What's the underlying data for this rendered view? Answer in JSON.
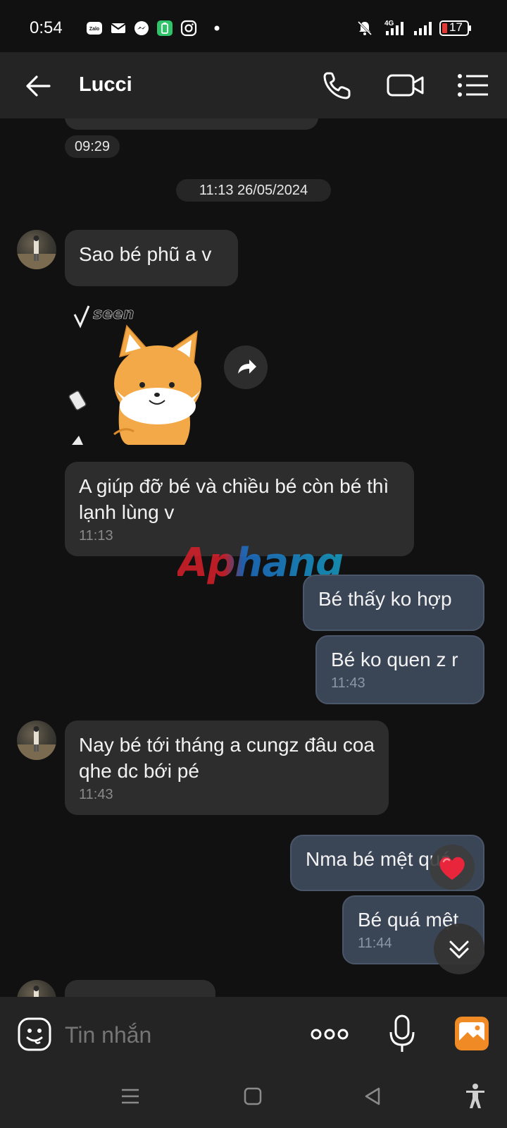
{
  "status_bar": {
    "time": "0:54",
    "battery": "17",
    "network": "4G",
    "icons": [
      "zalo-icon",
      "mail-icon",
      "messenger-icon",
      "battery-app-icon",
      "instagram-icon",
      "dot-icon",
      "mute-icon",
      "signal-icon",
      "battery-icon"
    ]
  },
  "header": {
    "title": "Lucci"
  },
  "messages": {
    "prev_time": "09:29",
    "date_divider": "11:13 26/05/2024",
    "m1": {
      "text": "Sao bé phũ a v"
    },
    "sticker": {
      "caption": "seen"
    },
    "m2": {
      "text": "A giúp đỡ bé và chiều bé còn bé thì lạnh lùng v",
      "time": "11:13"
    },
    "m3": {
      "text": "Bé thấy ko hợp"
    },
    "m4": {
      "text": "Bé ko quen z r",
      "time": "11:43"
    },
    "m5": {
      "text": "Nay bé tới tháng a cungz đâu coa qhe dc bới pé",
      "time": "11:43"
    },
    "m6": {
      "text": "Nma bé mệt quá"
    },
    "m7": {
      "text": "Bé quá mệt",
      "time": "11:44"
    }
  },
  "watermark": "Aphang",
  "input": {
    "placeholder": "Tin nhắn"
  },
  "colors": {
    "background": "#111111",
    "header": "#242424",
    "incoming_bubble": "#2d2d2d",
    "outgoing_bubble": "#3a4556",
    "gallery_accent": "#f08a24"
  }
}
